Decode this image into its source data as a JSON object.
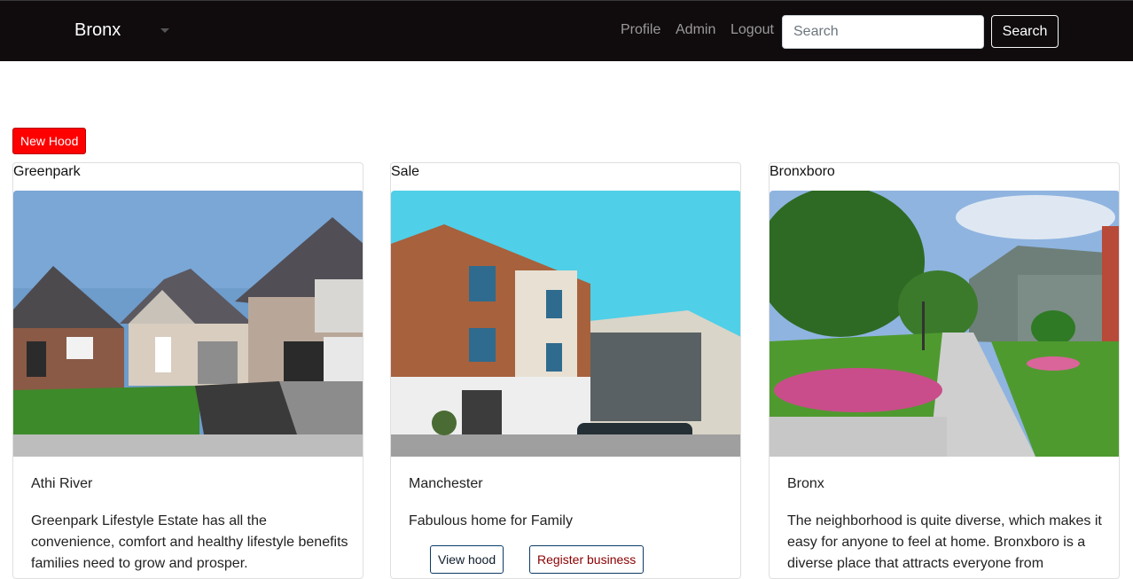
{
  "navbar": {
    "brand": "Bronx",
    "links": [
      "Profile",
      "Admin",
      "Logout"
    ],
    "search_placeholder": "Search",
    "search_button": "Search"
  },
  "actions": {
    "new_hood": "New Hood"
  },
  "cards": [
    {
      "title": "Greenpark",
      "location": "Athi River",
      "description": "Greenpark Lifestyle Estate has all the convenience, comfort and healthy lifestyle benefits families need to grow and prosper."
    },
    {
      "title": "Sale",
      "location": "Manchester",
      "description": "Fabulous home for Family",
      "view_button": "View hood",
      "register_button": "Register business"
    },
    {
      "title": "Bronxboro",
      "location": "Bronx",
      "description": "The neighborhood is quite diverse, which makes it easy for anyone to feel at home. Bronxboro is a diverse place that attracts everyone from"
    }
  ],
  "colors": {
    "navbar_bg": "#100c0e",
    "new_hood_bg": "#ff0000",
    "register_text": "#8b0000",
    "view_text": "#0d3b66"
  }
}
